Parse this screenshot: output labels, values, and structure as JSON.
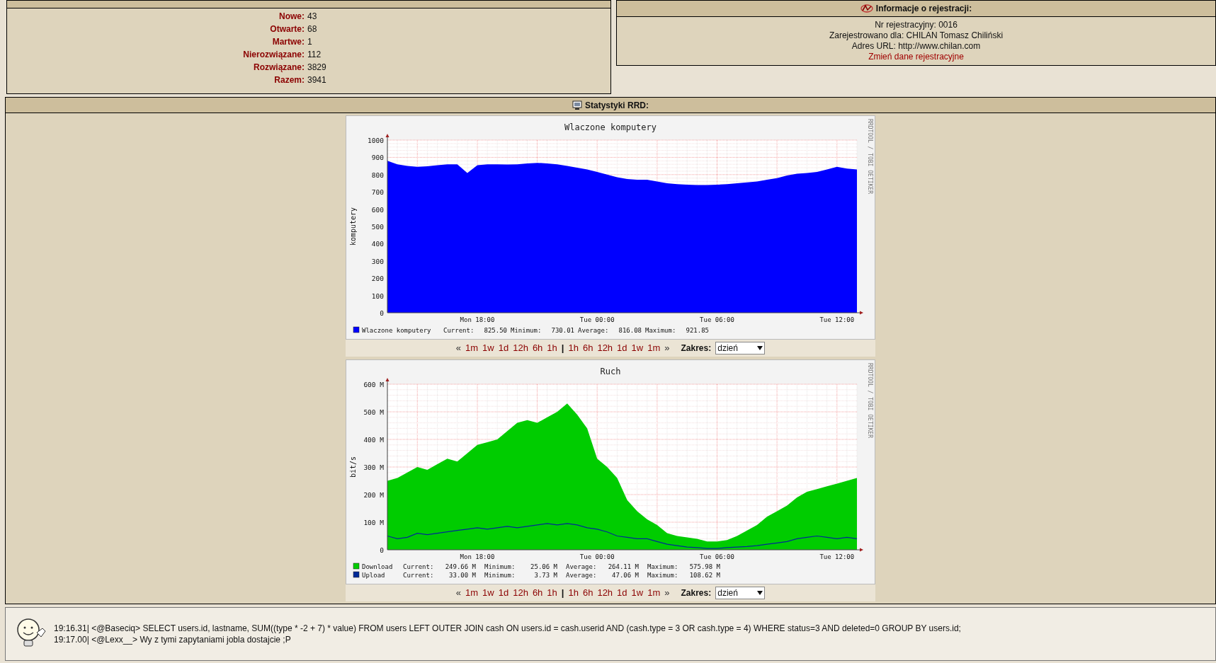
{
  "tickets": {
    "stats": [
      {
        "label": "Nowe:",
        "value": "43"
      },
      {
        "label": "Otwarte:",
        "value": "68"
      },
      {
        "label": "Martwe:",
        "value": "1"
      },
      {
        "label": "Nierozwiązane:",
        "value": "112"
      },
      {
        "label": "Rozwiązane:",
        "value": "3829"
      },
      {
        "label": "Razem:",
        "value": "3941"
      }
    ]
  },
  "registration": {
    "title": "Informacje o rejestracji:",
    "lines": [
      "Nr rejestracyjny: 0016",
      "Zarejestrowano dla: CHILAN Tomasz Chiliński",
      "Adres URL: http://www.chilan.com"
    ],
    "link": "Zmień dane rejestracyjne"
  },
  "rrd": {
    "title": "Statystyki RRD:",
    "graphs": [
      {
        "credit": "RRDTOOL / TOBI OETIKER",
        "legend": [
          {
            "stats": [
              {
                "name": "Current:",
                "value": "825.50"
              },
              {
                "name": "Minimum:",
                "value": "730.01"
              },
              {
                "name": "Average:",
                "value": "816.08"
              },
              {
                "name": "Maximum:",
                "value": "921.85"
              }
            ]
          }
        ],
        "chart_data": {
          "type": "area",
          "title": "Wlaczone komputery",
          "ylabel": "komputery",
          "grid": true,
          "legend": "bottom",
          "ylim": [
            0,
            1000
          ],
          "yticks": [
            0,
            100,
            200,
            300,
            400,
            500,
            600,
            700,
            800,
            900,
            1000
          ],
          "categories": [
            null,
            null,
            null,
            null,
            null,
            null,
            null,
            null,
            null,
            "Mon 18:00",
            null,
            null,
            null,
            null,
            null,
            null,
            null,
            null,
            null,
            null,
            null,
            "Tue 00:00",
            null,
            null,
            null,
            null,
            null,
            null,
            null,
            null,
            null,
            null,
            null,
            "Tue 06:00",
            null,
            null,
            null,
            null,
            null,
            null,
            null,
            null,
            null,
            null,
            null,
            "Tue 12:00",
            null,
            null
          ],
          "series": [
            {
              "name": "Wlaczone komputery",
              "color": "#0000ff",
              "values": [
                880,
                860,
                850,
                845,
                848,
                855,
                860,
                860,
                810,
                855,
                860,
                860,
                858,
                860,
                865,
                868,
                865,
                860,
                850,
                840,
                830,
                815,
                800,
                785,
                775,
                770,
                770,
                760,
                750,
                745,
                742,
                740,
                740,
                742,
                745,
                750,
                755,
                760,
                770,
                780,
                795,
                805,
                810,
                815,
                830,
                845,
                835,
                830
              ]
            }
          ]
        },
        "nav": {
          "prev": "«",
          "back": [
            "1m",
            "1w",
            "1d",
            "12h",
            "6h",
            "1h"
          ],
          "separator": "|",
          "forward": [
            "1h",
            "6h",
            "12h",
            "1d",
            "1w",
            "1m"
          ],
          "next": "»",
          "range_label": "Zakres:",
          "range_value": "dzień"
        }
      },
      {
        "credit": "RRDTOOL / TOBI OETIKER",
        "legend": [
          {
            "stats": [
              {
                "name": "Current:",
                "value": "249.66 M"
              },
              {
                "name": "Minimum:",
                "value": "25.06 M"
              },
              {
                "name": "Average:",
                "value": "264.11 M"
              },
              {
                "name": "Maximum:",
                "value": "575.98 M"
              }
            ]
          },
          {
            "stats": [
              {
                "name": "Current:",
                "value": "33.00 M"
              },
              {
                "name": "Minimum:",
                "value": "3.73 M"
              },
              {
                "name": "Average:",
                "value": "47.06 M"
              },
              {
                "name": "Maximum:",
                "value": "108.62 M"
              }
            ]
          }
        ],
        "chart_data": {
          "type": "area",
          "title": "Ruch",
          "ylabel": "bit/s",
          "grid": true,
          "legend": "bottom",
          "ylim": [
            0,
            600
          ],
          "yticks": [
            0,
            {
              "value": 100,
              "label": "100 M"
            },
            {
              "value": 200,
              "label": "200 M"
            },
            {
              "value": 300,
              "label": "300 M"
            },
            {
              "value": 400,
              "label": "400 M"
            },
            {
              "value": 500,
              "label": "500 M"
            },
            {
              "value": 600,
              "label": "600 M"
            }
          ],
          "categories": [
            null,
            null,
            null,
            null,
            null,
            null,
            null,
            null,
            null,
            "Mon 18:00",
            null,
            null,
            null,
            null,
            null,
            null,
            null,
            null,
            null,
            null,
            null,
            "Tue 00:00",
            null,
            null,
            null,
            null,
            null,
            null,
            null,
            null,
            null,
            null,
            null,
            "Tue 06:00",
            null,
            null,
            null,
            null,
            null,
            null,
            null,
            null,
            null,
            null,
            null,
            "Tue 12:00",
            null,
            null
          ],
          "series": [
            {
              "name": "Download",
              "color": "#00cc00",
              "values": [
                250,
                260,
                280,
                300,
                290,
                310,
                330,
                320,
                350,
                380,
                390,
                400,
                430,
                460,
                470,
                460,
                480,
                500,
                530,
                490,
                440,
                330,
                300,
                260,
                180,
                140,
                110,
                90,
                60,
                50,
                45,
                40,
                30,
                30,
                35,
                50,
                70,
                90,
                120,
                140,
                160,
                190,
                210,
                220,
                230,
                240,
                250,
                260
              ]
            },
            {
              "name": "Upload",
              "color": "#002a97",
              "type": "line",
              "values": [
                50,
                40,
                45,
                60,
                55,
                60,
                65,
                70,
                75,
                80,
                75,
                80,
                85,
                80,
                85,
                90,
                95,
                90,
                95,
                90,
                80,
                75,
                65,
                50,
                45,
                40,
                40,
                30,
                20,
                15,
                10,
                8,
                5,
                5,
                8,
                10,
                12,
                15,
                20,
                25,
                30,
                40,
                45,
                50,
                45,
                40,
                45,
                40
              ]
            }
          ]
        },
        "nav": {
          "prev": "«",
          "back": [
            "1m",
            "1w",
            "1d",
            "12h",
            "6h",
            "1h"
          ],
          "separator": "|",
          "forward": [
            "1h",
            "6h",
            "12h",
            "1d",
            "1w",
            "1m"
          ],
          "next": "»",
          "range_label": "Zakres:",
          "range_value": "dzień"
        }
      }
    ]
  },
  "shoutbox": {
    "messages": [
      "19:16.31| <@Baseciq> SELECT users.id, lastname, SUM((type * -2 + 7) * value) FROM users LEFT OUTER JOIN cash ON users.id = cash.userid AND (cash.type = 3 OR cash.type = 4) WHERE status=3 AND deleted=0 GROUP BY users.id;",
      "19:17.00| <@Lexx__> Wy z tymi zapytaniami jobla dostajcie ;P"
    ]
  }
}
